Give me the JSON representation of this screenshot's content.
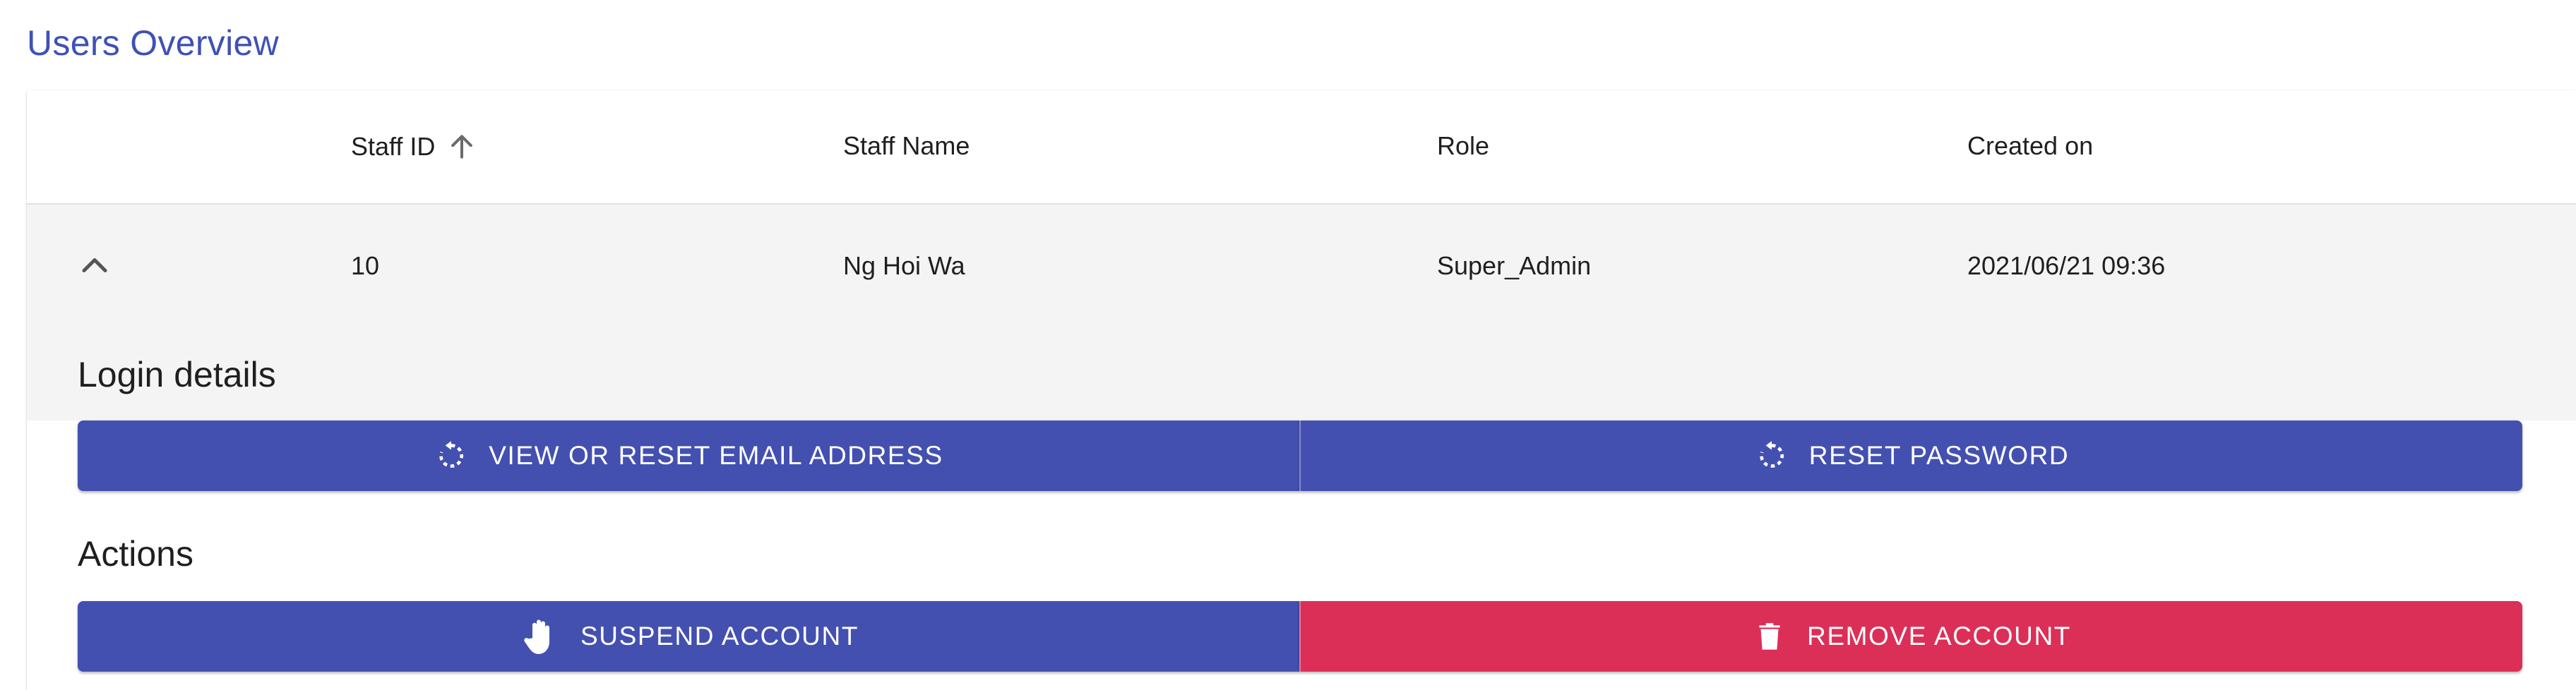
{
  "page": {
    "title": "Users Overview"
  },
  "table": {
    "headers": {
      "staff_id": "Staff ID",
      "staff_name": "Staff Name",
      "role": "Role",
      "created_on": "Created on"
    },
    "sort": {
      "column": "staff_id",
      "direction": "ascending",
      "icon": "arrow-up-icon"
    },
    "row": {
      "staff_id": "10",
      "staff_name": "Ng Hoi Wa",
      "role": "Super_Admin",
      "created_on": "2021/06/21 09:36",
      "expanded": true,
      "expand_icon": "chevron-up-icon"
    }
  },
  "details": {
    "login_label": "Login details",
    "actions_label": "Actions",
    "buttons": {
      "reset_email": {
        "label": "VIEW OR RESET EMAIL ADDRESS",
        "icon": "restart-icon"
      },
      "reset_password": {
        "label": "RESET PASSWORD",
        "icon": "restart-icon"
      },
      "suspend": {
        "label": "SUSPEND ACCOUNT",
        "icon": "hand-stop-icon"
      },
      "remove": {
        "label": "REMOVE ACCOUNT",
        "icon": "trash-icon"
      }
    }
  },
  "colors": {
    "primary": "#4450b0",
    "danger": "#dc2f58",
    "title": "#3f51b5",
    "row_bg": "#f4f4f4"
  }
}
